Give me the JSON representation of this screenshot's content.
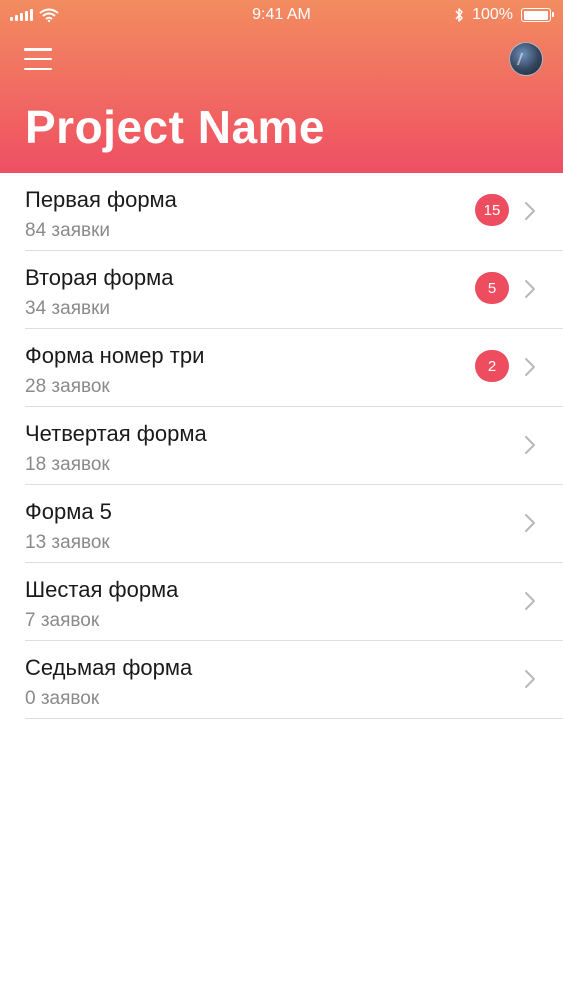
{
  "status_bar": {
    "time": "9:41 AM",
    "battery": "100%",
    "battery_level": 1.0
  },
  "header": {
    "title": "Project Name",
    "gradient_colors": [
      "#f28c5f",
      "#ee4f63"
    ]
  },
  "forms": [
    {
      "title": "Первая форма",
      "subtitle": "84 заявки",
      "badge": "15"
    },
    {
      "title": "Вторая форма",
      "subtitle": "34 заявки",
      "badge": "5"
    },
    {
      "title": "Форма номер три",
      "subtitle": "28 заявок",
      "badge": "2"
    },
    {
      "title": "Четвертая форма",
      "subtitle": "18 заявок",
      "badge": null
    },
    {
      "title": "Форма 5",
      "subtitle": "13 заявок",
      "badge": null
    },
    {
      "title": "Шестая форма",
      "subtitle": "7 заявок",
      "badge": null
    },
    {
      "title": "Седьмая форма",
      "subtitle": "0 заявок",
      "badge": null
    }
  ],
  "colors": {
    "accent": "#ee4c5f",
    "chevron": "#b8b8b8"
  },
  "icons": {
    "menu": "menu-icon",
    "avatar": "avatar",
    "chevron": "chevron-right-icon",
    "signal": "signal-icon",
    "wifi": "wifi-icon",
    "bluetooth": "bluetooth-icon",
    "battery": "battery-icon"
  }
}
